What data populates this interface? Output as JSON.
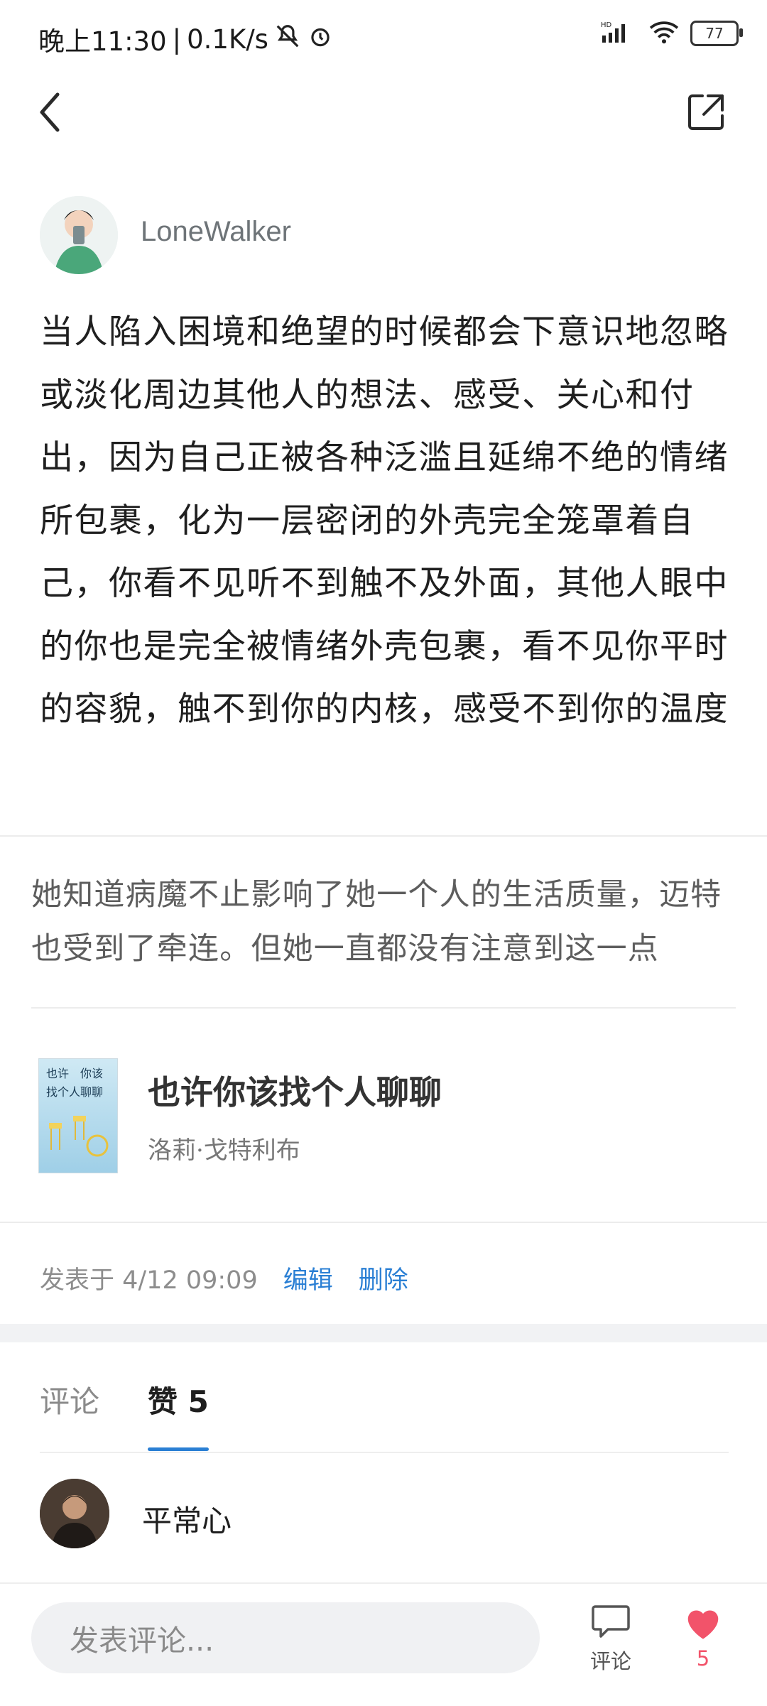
{
  "status_bar": {
    "time": "晚上11:30",
    "network_speed": "0.1K/s",
    "signal_label": "HD",
    "battery_level": "77"
  },
  "nav": {
    "back_icon": "chevron-left-icon",
    "share_icon": "share-external-icon"
  },
  "author": {
    "name": "LoneWalker"
  },
  "post": {
    "body": "当人陷入困境和绝望的时候都会下意识地忽略或淡化周边其他人的想法、感受、关心和付出，因为自己正被各种泛滥且延绵不绝的情绪所包裹，化为一层密闭的外壳完全笼罩着自己，你看不见听不到触不及外面，其他人眼中的你也是完全被情绪外壳包裹，看不见你平时的容貌，触不到你的内核，感受不到你的温度",
    "quote": "她知道病魔不止影响了她一个人的生活质量，迈特也受到了牵连。但她一直都没有注意到这一点"
  },
  "book": {
    "title": "也许你该找个人聊聊",
    "author": "洛莉·戈特利布",
    "cover_text_line1": "也许　你该",
    "cover_text_line2": "找个人聊聊"
  },
  "meta": {
    "published": "发表于 4/12 09:09",
    "edit_label": "编辑",
    "delete_label": "删除"
  },
  "tabs": {
    "comments_label": "评论",
    "likes_label": "赞 5"
  },
  "likers": [
    {
      "name": "平常心"
    }
  ],
  "bottom_bar": {
    "input_placeholder": "发表评论...",
    "comment_label": "评论",
    "like_count": "5"
  },
  "colors": {
    "link": "#2a7fd4",
    "like": "#f2536a",
    "tab_underline": "#2a7fd4"
  }
}
